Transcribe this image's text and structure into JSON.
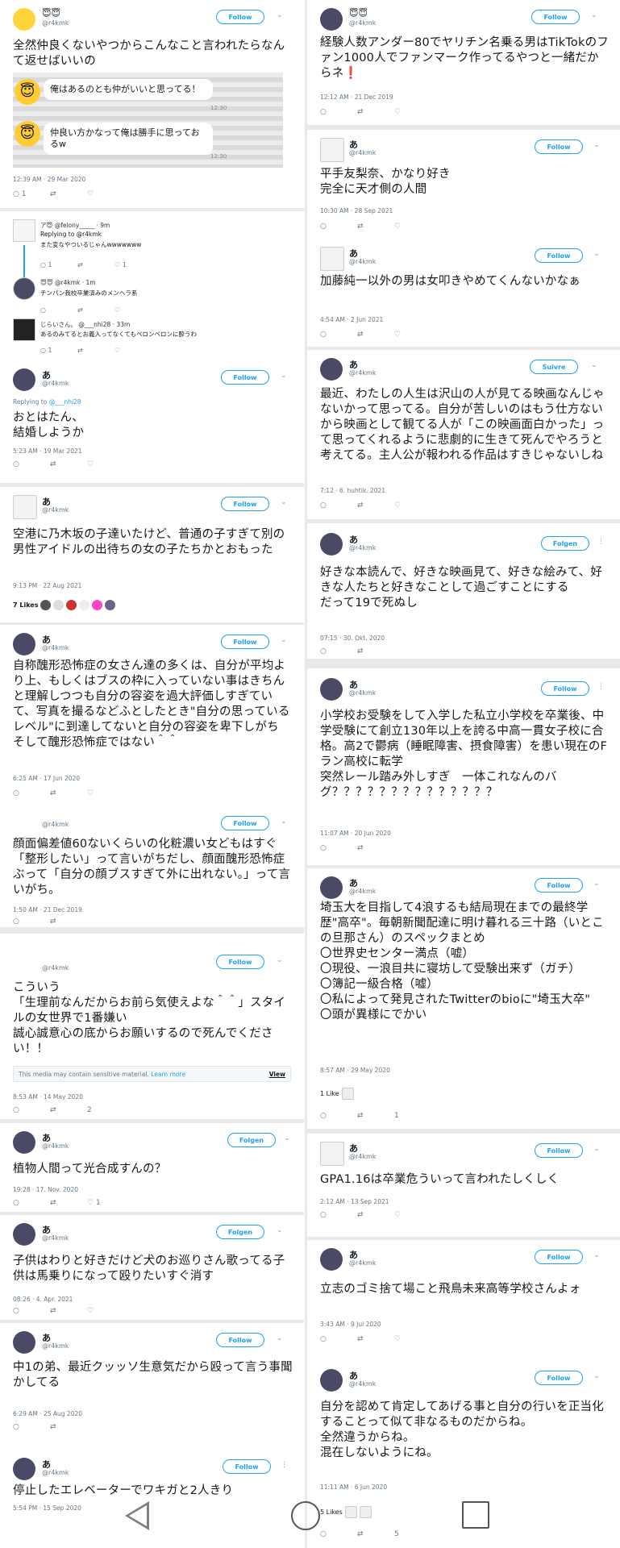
{
  "follow_label": "Follow",
  "follow_label_alt": "Folgen",
  "follow_label_fr": "Suivre",
  "sensitive": {
    "text": "This media may contain sensitive material.",
    "learn": "Learn more",
    "view": "View"
  },
  "nav": {
    "back": "back-icon",
    "home": "home-icon",
    "recent": "recent-apps-icon"
  },
  "left": [
    {
      "name": "😇😇",
      "handle": "@r4kmk",
      "text": "全然仲良くないやつからこんなこと言われたらなんて返せばいいの",
      "chat": [
        {
          "text": "俺はあるのとも仲がいいと思ってる！",
          "time": "12:30"
        },
        {
          "text": "仲良い方かなって俺は勝手に思っておるw",
          "time": "12:30"
        }
      ],
      "meta": "12:39 AM · 29 Mar 2020",
      "counts": [
        "1",
        "",
        ""
      ]
    },
    {
      "replies": [
        {
          "name": "ア😇 @felony_____ · 9m",
          "sub": "Replying to @r4kmk",
          "text": "また変なやついるじゃんwwwwwww",
          "counts": [
            "1",
            "",
            "1"
          ]
        },
        {
          "name": "😇😇 @r4kmk · 1m",
          "text": "チンパン我校卒業済みのメンヘラ系",
          "counts": [
            "",
            "",
            ""
          ]
        },
        {
          "name": "じらいさん。 @___nhi28 · 33m",
          "text": "あるのみてるとお義入ってなくてもベロンベロンに酔うわ",
          "counts": [
            "1",
            "",
            ""
          ]
        }
      ]
    },
    {
      "name": "あ",
      "handle": "@r4kmk",
      "reply_label": "Replying to",
      "reply_to": "@___nhi28",
      "text": "おとはたん、\n結婚しようか",
      "meta": "5:23 AM · 19 Mar 2021"
    },
    {
      "name": "あ",
      "handle": "@r4kmk",
      "text": "空港に乃木坂の子達いたけど、普通の子すぎて別の男性アイドルの出待ちの女の子たちかとおもった",
      "meta": "9:13 PM · 22 Aug 2021",
      "likes": "7 Likes"
    },
    {
      "name": "あ",
      "handle": "@r4kmk",
      "text": "自称醜形恐怖症の女さん達の多くは、自分が平均より上、もしくはブスの枠に入っていない事はきちんと理解しつつも自分の容姿を過大評価しすぎていて、写真を撮るなどふとしたとき\"自分の思っているレベル\"に到達してないと自分の容姿を卑下しがち\nそして醜形恐怖症ではない＾＾",
      "meta": "6:25 AM · 17 Jun 2020"
    },
    {
      "name": "",
      "handle": "@r4kmk",
      "text": "顔面偏差値60ないくらいの化粧濃い女どもはすぐ「整形したい」って言いがちだし、顔面醜形恐怖症ぶって「自分の顔ブスすぎて外に出れない。」って言いがち。",
      "meta": "1:50 AM · 21 Dec 2019"
    },
    {
      "name": "",
      "handle": "@r4kmk",
      "text": "こういう\n「生理前なんだからお前ら気使えよな＾＾」スタイルの女世界で1番嫌い\n誠心誠意心の底からお願いするので死んでください！！",
      "meta": "8:53 AM · 14 May 2020",
      "counts": [
        "",
        "",
        "2"
      ]
    },
    {
      "name": "あ",
      "handle": "@r4kmk",
      "text": "植物人間って光合成すんの？",
      "meta": "19:28 · 17. Nov. 2020",
      "counts": [
        "",
        "",
        "1"
      ]
    },
    {
      "name": "あ",
      "handle": "@r4kmk",
      "text": "子供はわりと好きだけど犬のお巡りさん歌ってる子供は馬乗りになって殴りたいすぐ消す",
      "meta": "08:26 · 4. Apr. 2021"
    },
    {
      "name": "あ",
      "handle": "@r4kmk",
      "text": "中1の弟、最近クッッソ生意気だから殴って言う事聞かしてる",
      "meta": "6:29 AM · 25 Aug 2020"
    },
    {
      "name": "あ",
      "handle": "@r4kmk",
      "text": "停止したエレベーターでワキガと2人きり",
      "meta": "5:54 PM · 15 Sep 2020"
    }
  ],
  "right": [
    {
      "name": "😇😇",
      "handle": "@r4kmk",
      "text": "経験人数アンダー80でヤリチン名乗る男はTikTokのファン1000人でファンマーク作ってるやつと一緒だからネ❗",
      "meta": "12:12 AM · 21 Dec 2019"
    },
    {
      "name": "あ",
      "handle": "@r4kmk",
      "text": "平手友梨奈、かなり好き\n完全に天才側の人間",
      "meta": "10:30 AM · 28 Sep 2021"
    },
    {
      "name": "あ",
      "handle": "@r4kmk",
      "text": "加藤純一以外の男は女叩きやめてくんないかなぁ",
      "meta": "4:54 AM · 2 Jun 2021"
    },
    {
      "name": "あ",
      "handle": "@r4kmk",
      "text": "最近、わたしの人生は沢山の人が見てる映画なんじゃないかって思ってる。自分が苦しいのはもう仕方ないから映画として観てる人が「この映画面白かった」って思ってくれるように悲劇的に生きて死んでやろうと考えてる。主人公が報われる作品はすきじゃないしね",
      "meta": "7:12 · 6. huhtik. 2021"
    },
    {
      "name": "あ",
      "handle": "@r4kmk",
      "text": "好きな本読んで、好きな映画見て、好きな絵みて、好きな人たちと好きなことして過ごすことにする\nだって19で死ぬし",
      "meta": "07:15 · 30. Okt. 2020"
    },
    {
      "name": "あ",
      "handle": "@r4kmk",
      "text": "小学校お受験をして入学した私立小学校を卒業後、中学受験にて創立130年以上を誇る中高一貫女子校に合格。高2で鬱病（睡眠障害、摂食障害）を患い現在のFラン高校に転学\n突然レール踏み外しすぎ　一体これなんのバグ？？？？？？？？？？？？？？",
      "meta": "11:07 AM · 20 Jun 2020"
    },
    {
      "name": "あ",
      "handle": "@r4kmk",
      "text": "埼玉大を目指して4浪するも結局現在までの最終学歴\"高卒\"。毎朝新聞配達に明け暮れる三十路（いとこの旦那さん）のスペックまとめ\n〇世界史センター満点（嘘）\n〇現役、一浪目共に寝坊して受験出来ず（ガチ）\n〇簿記一級合格（嘘）\n〇私によって発見されたTwitterのbioに\"埼玉大卒\"\n〇頭が異様にでかい",
      "meta": "8:57 AM · 29 May 2020",
      "likes": "1 Like",
      "counts": [
        "",
        "",
        "1"
      ]
    },
    {
      "name": "あ",
      "handle": "@r4kmk",
      "text": "GPA1.16は卒業危ういって言われたしくしく",
      "meta": "2:12 AM · 13 Sep 2021"
    },
    {
      "name": "あ",
      "handle": "@r4kmk",
      "text": "立志のゴミ捨て場こと飛鳥未来高等学校さんよォ",
      "meta": "3:43 AM · 9 Jul 2020"
    },
    {
      "name": "あ",
      "handle": "@r4kmk",
      "text": "自分を認めて肯定してあげる事と自分の行いを正当化することって似て非なるものだからね。\n全然違うからね。\n混在しないようにね。",
      "meta": "11:11 AM · 6 Jun 2020",
      "likes": "5 Likes",
      "counts": [
        "",
        "",
        "5"
      ]
    }
  ],
  "icons": {
    "reply": "💬",
    "retweet": "⇄",
    "like": "♡"
  }
}
